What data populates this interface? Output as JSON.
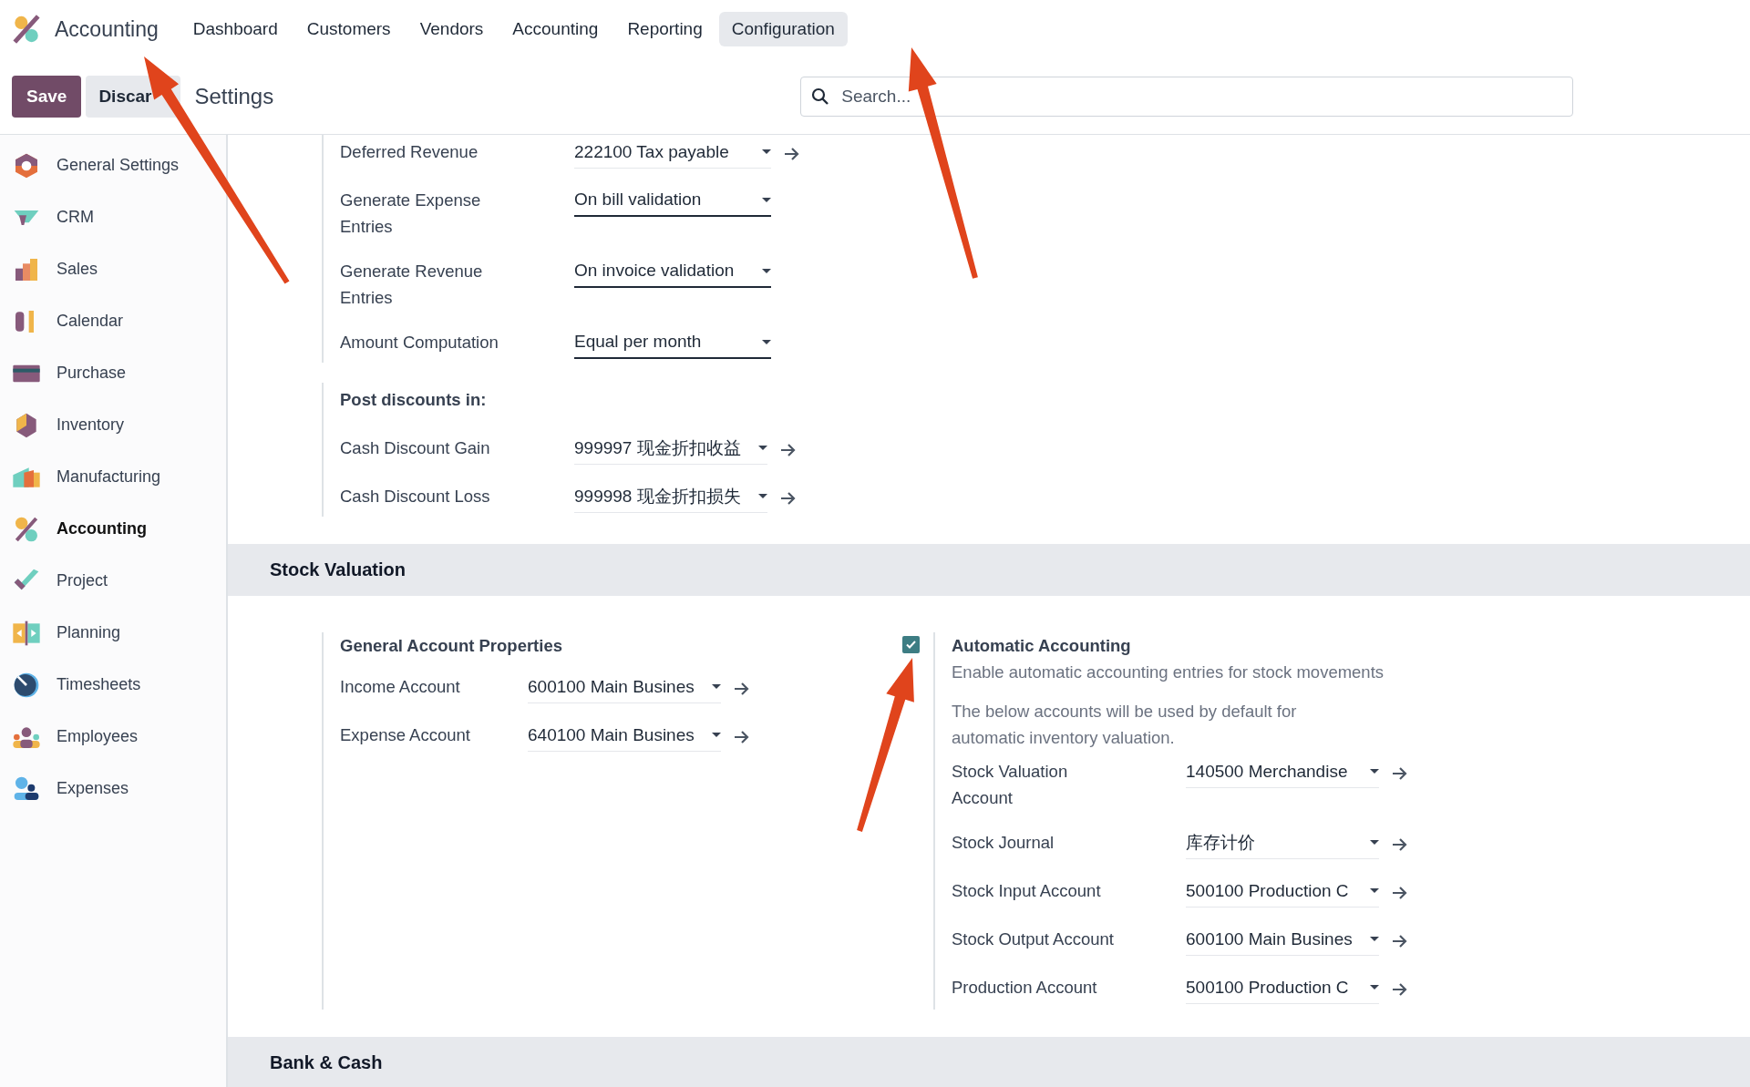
{
  "app": {
    "name": "Accounting"
  },
  "nav": [
    {
      "label": "Dashboard",
      "selected": false
    },
    {
      "label": "Customers",
      "selected": false
    },
    {
      "label": "Vendors",
      "selected": false
    },
    {
      "label": "Accounting",
      "selected": false
    },
    {
      "label": "Reporting",
      "selected": false
    },
    {
      "label": "Configuration",
      "selected": true
    }
  ],
  "control_panel": {
    "save": "Save",
    "discard": "Discar",
    "title": "Settings",
    "search": {
      "placeholder": "Search..."
    }
  },
  "sidebar": {
    "items": [
      {
        "label": "General Settings",
        "selected": false
      },
      {
        "label": "CRM",
        "selected": false
      },
      {
        "label": "Sales",
        "selected": false
      },
      {
        "label": "Calendar",
        "selected": false
      },
      {
        "label": "Purchase",
        "selected": false
      },
      {
        "label": "Inventory",
        "selected": false
      },
      {
        "label": "Manufacturing",
        "selected": false
      },
      {
        "label": "Accounting",
        "selected": true
      },
      {
        "label": "Project",
        "selected": false
      },
      {
        "label": "Planning",
        "selected": false
      },
      {
        "label": "Timesheets",
        "selected": false
      },
      {
        "label": "Employees",
        "selected": false
      },
      {
        "label": "Expenses",
        "selected": false
      }
    ]
  },
  "deferred": {
    "rows": [
      {
        "label": "Deferred Revenue",
        "value": "222100 Tax payable",
        "kind": "link"
      },
      {
        "label": "Generate Expense Entries",
        "value": "On bill validation",
        "kind": "select"
      },
      {
        "label": "Generate Revenue Entries",
        "value": "On invoice validation",
        "kind": "select"
      },
      {
        "label": "Amount Computation",
        "value": "Equal per month",
        "kind": "select"
      }
    ]
  },
  "post_discounts": {
    "title": "Post discounts in:",
    "rows": [
      {
        "label": "Cash Discount Gain",
        "value": "999997 现金折扣收益",
        "kind": "link"
      },
      {
        "label": "Cash Discount Loss",
        "value": "999998 现金折扣损失",
        "kind": "link"
      }
    ]
  },
  "sections": [
    {
      "title": "Stock Valuation",
      "settings": [
        {
          "title": "General Account Properties",
          "rows": [
            {
              "label": "Income Account",
              "value": "600100 Main Busines",
              "kind": "link"
            },
            {
              "label": "Expense Account",
              "value": "640100 Main Busines",
              "kind": "link"
            }
          ]
        },
        {
          "title": "Automatic Accounting",
          "checked": true,
          "description": "Enable automatic accounting entries for stock movements",
          "note": "The below accounts will be used by default for automatic inventory valuation.",
          "rows": [
            {
              "label": "Stock Valuation Account",
              "value": "140500 Merchandise",
              "kind": "link"
            },
            {
              "label": "Stock Journal",
              "value": "库存计价",
              "kind": "link"
            },
            {
              "label": "Stock Input Account",
              "value": "500100 Production C",
              "kind": "link"
            },
            {
              "label": "Stock Output Account",
              "value": "600100 Main Busines",
              "kind": "link"
            },
            {
              "label": "Production Account",
              "value": "500100 Production C",
              "kind": "link"
            }
          ]
        }
      ]
    },
    {
      "title": "Bank & Cash"
    }
  ]
}
